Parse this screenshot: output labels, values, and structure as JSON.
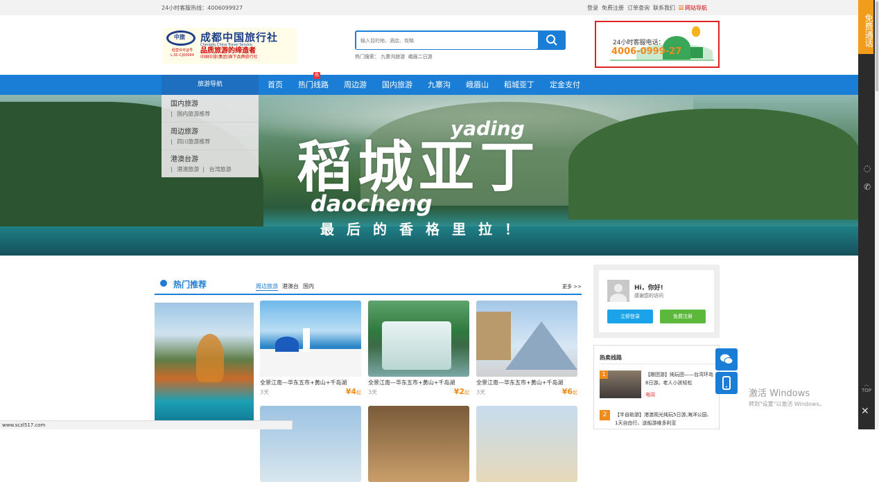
{
  "topbar": {
    "hotline": "24小时客服热线：4006099927",
    "links": [
      "登录",
      "免费注册",
      "订单查询",
      "联系我们"
    ],
    "site_nav": "网站导航"
  },
  "logo": {
    "mark_cn": "中旅",
    "license_1": "经营许可证号",
    "license_2": "L-SC-CJ00044",
    "name": "成都中国旅行社",
    "name_en": "Chengdu China Travel Service",
    "slogan": "品质旅游的缔造者",
    "sub": "中国中旅(集团)旗下品牌旅行社"
  },
  "search": {
    "placeholder": "输入目的地、酒店、攻略",
    "hot_label": "热门搜索：",
    "hot_terms": [
      "九寨沟旅游",
      "峨眉二日游"
    ]
  },
  "service": {
    "label": "24小时客服电话：",
    "number": "4006-0999-27"
  },
  "nav": {
    "guide": "旅游导航",
    "items": [
      "首页",
      "热门线路",
      "周边游",
      "国内旅游",
      "九寨沟",
      "峨眉山",
      "稻城亚丁",
      "定金支付"
    ],
    "hot_badge": "热"
  },
  "dropdown": [
    {
      "title": "国内旅游",
      "subs": [
        "国内旅游推荐"
      ]
    },
    {
      "title": "周边旅游",
      "subs": [
        "四川旅游推荐"
      ]
    },
    {
      "title": "港澳台游",
      "subs": [
        "港澳旅游",
        "台湾旅游"
      ]
    }
  ],
  "banner": {
    "title": "稻城亚丁",
    "pinyin_1": "yading",
    "pinyin_2": "daocheng",
    "subtitle": "最后的香格里拉！"
  },
  "hot_rec": {
    "title": "热门推荐",
    "tabs": [
      "周边旅游",
      "港澳台",
      "国内"
    ],
    "more": "更多 >>"
  },
  "cards": [
    {
      "name": "全景江南—华东五市+黄山+千岛湖",
      "days": "3天",
      "price": "¥4",
      "unit": "起"
    },
    {
      "name": "全景江南—华东五市+黄山+千岛湖",
      "days": "3天",
      "price": "¥2",
      "unit": "起"
    },
    {
      "name": "全景江南—华东五市+黄山+千岛湖",
      "days": "3天",
      "price": "¥6",
      "unit": "起"
    }
  ],
  "user": {
    "hi": "Hi，你好!",
    "thanks": "感谢您的访问",
    "login": "立即登录",
    "register": "免费注册"
  },
  "hot_sell": {
    "title": "热卖线路",
    "items": [
      {
        "rank": "1",
        "text": "【跟团游】纯玩团——台湾环岛8日游。老人小孩轻松",
        "tag": "电阅"
      },
      {
        "rank": "2",
        "text": "【半自助游】港澳观光纯玩5日游,海洋公园、1天自由行、送船游维多利亚"
      }
    ]
  },
  "side": {
    "free_call": "免费通话",
    "top": "TOP",
    "close": "✕"
  },
  "activate": {
    "line1": "激活 Windows",
    "line2": "转到\"设置\"以激活 Windows。"
  },
  "status_url": "www.sczl517.com"
}
